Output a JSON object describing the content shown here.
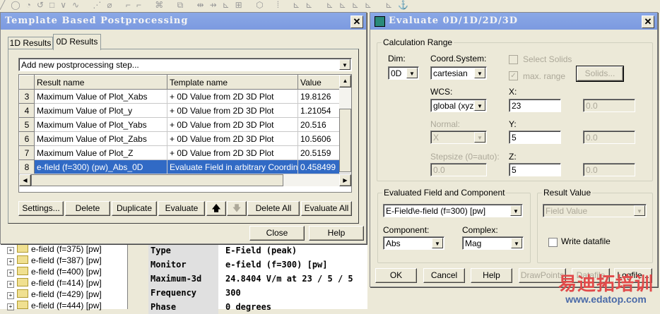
{
  "template_dialog": {
    "title": "Template Based Postprocessing",
    "tabs": [
      {
        "label": "1D Results"
      },
      {
        "label": "0D Results"
      }
    ],
    "add_step_placeholder": "Add new postprocessing step...",
    "columns": [
      "Result name",
      "Template name",
      "Value"
    ],
    "rows": [
      {
        "num": "3",
        "name": "Maximum Value of Plot_Xabs",
        "template": "+ 0D Value from 2D 3D Plot",
        "value": "19.8126"
      },
      {
        "num": "4",
        "name": "Maximum Value of Plot_y",
        "template": "+ 0D Value from 2D 3D Plot",
        "value": "1.21054"
      },
      {
        "num": "5",
        "name": "Maximum Value of Plot_Yabs",
        "template": "+ 0D Value from 2D 3D Plot",
        "value": "20.516"
      },
      {
        "num": "6",
        "name": "Maximum Value of Plot_Zabs",
        "template": "+ 0D Value from 2D 3D Plot",
        "value": "10.5606"
      },
      {
        "num": "7",
        "name": "Maximum Value of Plot_Z",
        "template": "+ 0D Value from 2D 3D Plot",
        "value": "20.5159"
      },
      {
        "num": "8",
        "name": "e-field (f=300) (pw)_Abs_0D",
        "template": "Evaluate Field in arbitrary Coordina",
        "value": "0.458499",
        "selected": true
      }
    ],
    "buttons": {
      "settings": "Settings...",
      "delete": "Delete",
      "duplicate": "Duplicate",
      "evaluate": "Evaluate",
      "up": "🡅",
      "down": "🡇",
      "delete_all": "Delete All",
      "evaluate_all": "Evaluate All",
      "close": "Close",
      "help": "Help"
    }
  },
  "tree": {
    "items": [
      "e-field (f=375) [pw]",
      "e-field (f=387) [pw]",
      "e-field (f=400) [pw]",
      "e-field (f=414) [pw]",
      "e-field (f=429) [pw]",
      "e-field (f=444) [pw]"
    ]
  },
  "properties": [
    {
      "key": "Type",
      "value": "E-Field (peak)"
    },
    {
      "key": "Monitor",
      "value": "e-field (f=300) [pw]"
    },
    {
      "key": "Maximum-3d",
      "value": "24.8404 V/m at 23 / 5 / 5"
    },
    {
      "key": "Frequency",
      "value": "300"
    },
    {
      "key": "Phase",
      "value": "0 degrees"
    }
  ],
  "evaluate_dialog": {
    "title": "Evaluate 0D/1D/2D/3D",
    "calc_range": {
      "legend": "Calculation Range",
      "dim_label": "Dim:",
      "dim": "0D",
      "coord_label": "Coord.System:",
      "coord": "cartesian",
      "wcs_label": "WCS:",
      "wcs": "global (xyz)",
      "normal_label": "Normal:",
      "normal": "X",
      "stepsize_label": "Stepsize (0=auto):",
      "stepsize": "0.0",
      "select_solids": "Select Solids",
      "max_range": "max. range",
      "solids_btn": "Solids...",
      "x_label": "X:",
      "x": "23",
      "x2": "0.0",
      "y_label": "Y:",
      "y": "5",
      "y2": "0.0",
      "z_label": "Z:",
      "z": "5",
      "z2": "0.0"
    },
    "field": {
      "legend": "Evaluated Field and Component",
      "field": "E-Field\\e-field (f=300) [pw]",
      "component_label": "Component:",
      "component": "Abs",
      "complex_label": "Complex:",
      "complex": "Mag"
    },
    "result": {
      "legend": "Result Value",
      "value": "Field Value",
      "write_datafile": "Write datafile"
    },
    "buttons": {
      "ok": "OK",
      "cancel": "Cancel",
      "help": "Help",
      "drawpoints": "DrawPoints",
      "datafile": "Datafile",
      "logfile": "Logfile..."
    }
  },
  "watermark": {
    "cn": "易迪拓培训",
    "url": "www.edatop.com"
  }
}
